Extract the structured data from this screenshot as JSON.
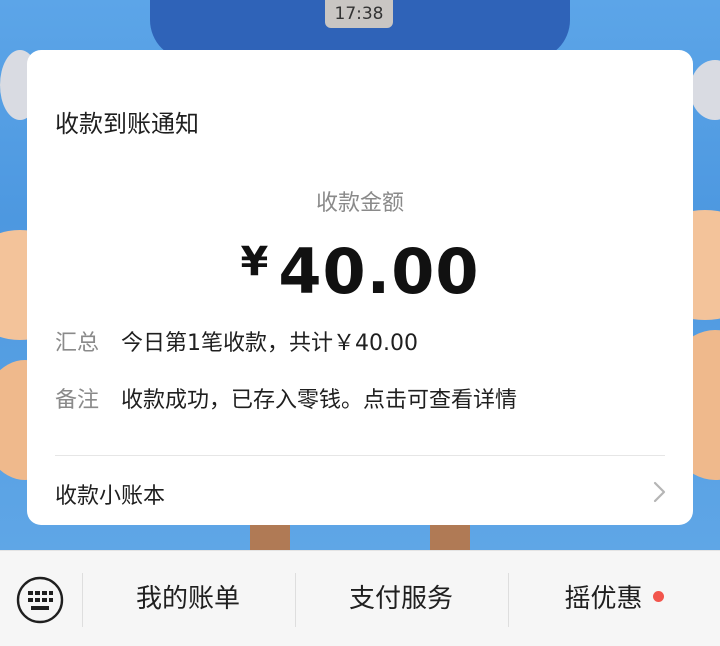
{
  "status": {
    "time": "17:38"
  },
  "card": {
    "title": "收款到账通知",
    "amount_label": "收款金额",
    "currency_symbol": "¥",
    "amount": "40.00",
    "rows": [
      {
        "key": "汇总",
        "value": "今日第1笔收款，共计￥40.00"
      },
      {
        "key": "备注",
        "value": "收款成功，已存入零钱。点击可查看详情"
      }
    ],
    "ledger_label": "收款小账本"
  },
  "bottom_menu": {
    "items": [
      "我的账单",
      "支付服务",
      "摇优惠"
    ],
    "badge_color": "#f2554c"
  }
}
